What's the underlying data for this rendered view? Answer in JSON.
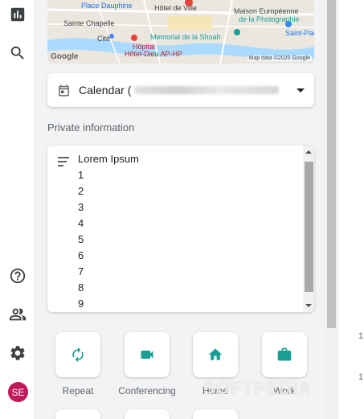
{
  "rail": {
    "items": [
      {
        "name": "reports-icon"
      },
      {
        "name": "search-icon"
      },
      {
        "name": "help-icon"
      },
      {
        "name": "people-icon"
      },
      {
        "name": "settings-icon"
      }
    ],
    "avatar_initials": "SE"
  },
  "map": {
    "labels": [
      "Place Dauphine",
      "Hôtel de Ville",
      "Maison Européenne",
      "de la Photographie",
      "Sainte Chapelle",
      "Cité",
      "Memorial de la Shoah",
      "Saint-Paul",
      "Hôpital",
      "Hôtel-Dieu AP-HP"
    ],
    "google": "Google",
    "copyright": "Map data ©2020 Google"
  },
  "calendar": {
    "label": "Calendar ("
  },
  "private_info": {
    "title": "Private information",
    "lines": [
      "Lorem Ipsum",
      "1",
      "2",
      "3",
      "4",
      "5",
      "6",
      "7",
      "8",
      "9"
    ]
  },
  "tiles": [
    {
      "label": "Repeat",
      "icon": "repeat-icon"
    },
    {
      "label": "Conferencing",
      "icon": "video-icon"
    },
    {
      "label": "Home",
      "icon": "home-icon"
    },
    {
      "label": "Work",
      "icon": "briefcase-icon"
    }
  ],
  "edge_numbers": [
    "1",
    "1"
  ],
  "watermark": "SOFTPEDIA",
  "colors": {
    "accent": "#1a9e94",
    "avatar": "#c2185b"
  }
}
